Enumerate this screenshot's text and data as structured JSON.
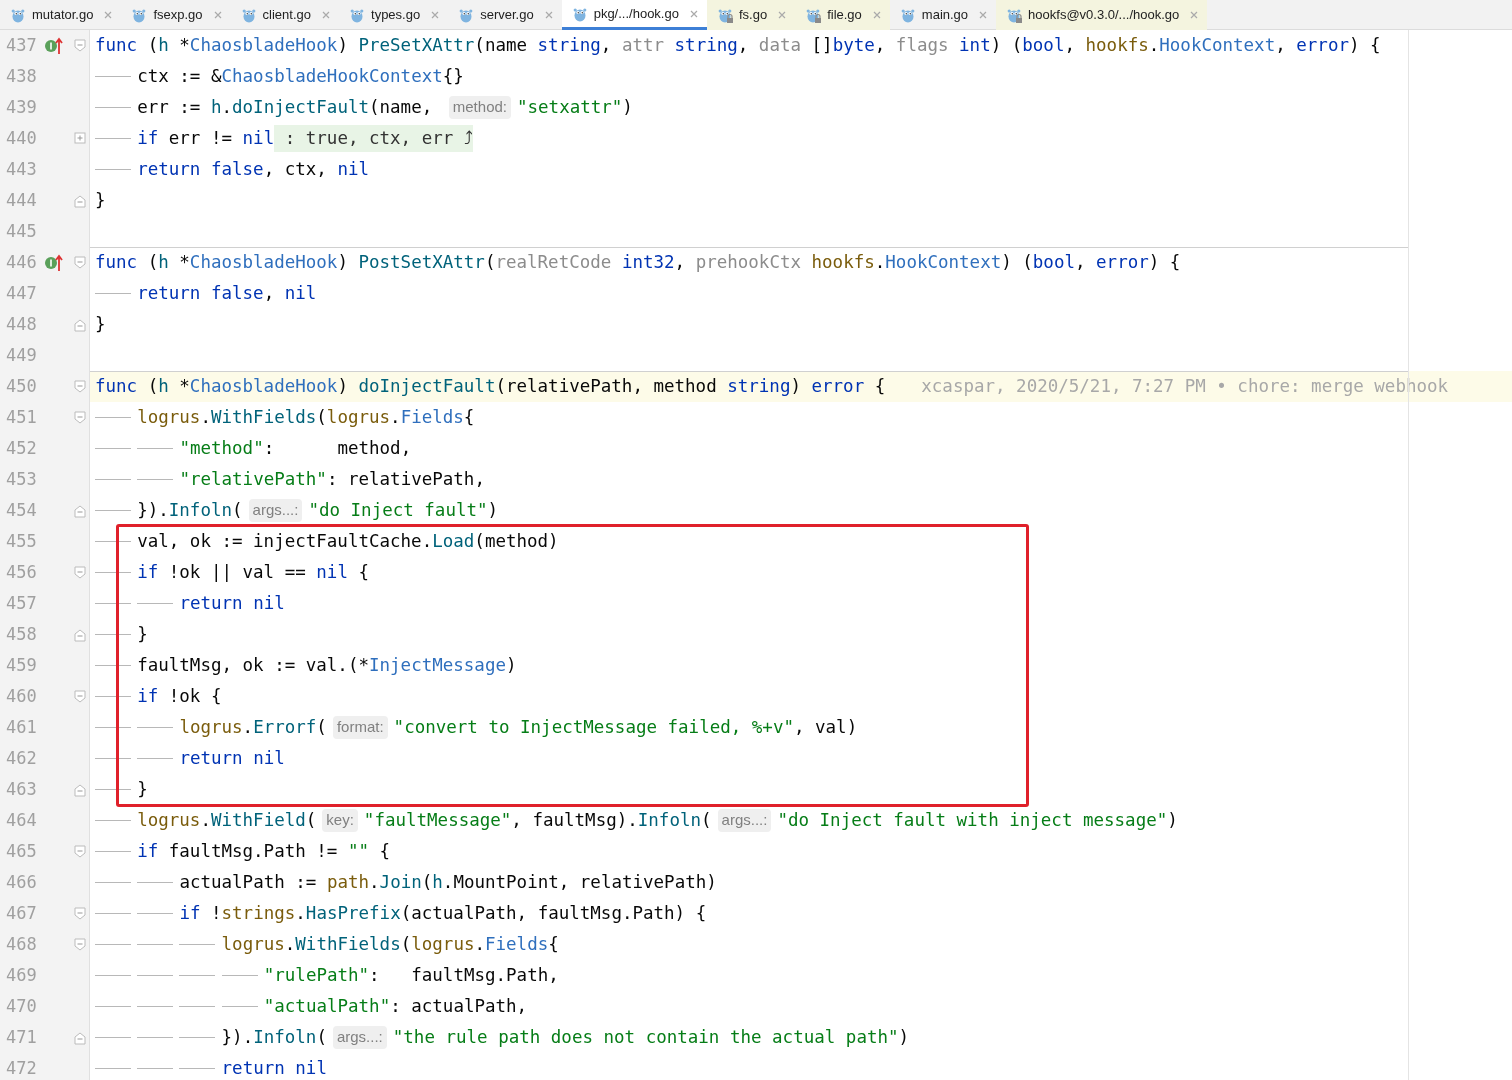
{
  "tabs": [
    {
      "label": "mutator.go",
      "selected": false,
      "library": false,
      "locked": false
    },
    {
      "label": "fsexp.go",
      "selected": false,
      "library": false,
      "locked": false
    },
    {
      "label": "client.go",
      "selected": false,
      "library": false,
      "locked": false
    },
    {
      "label": "types.go",
      "selected": false,
      "library": false,
      "locked": false
    },
    {
      "label": "server.go",
      "selected": false,
      "library": false,
      "locked": false
    },
    {
      "label": "pkg/.../hook.go",
      "selected": true,
      "library": false,
      "locked": false
    },
    {
      "label": "fs.go",
      "selected": false,
      "library": true,
      "locked": true
    },
    {
      "label": "file.go",
      "selected": false,
      "library": true,
      "locked": true
    },
    {
      "label": "main.go",
      "selected": false,
      "library": false,
      "locked": false
    },
    {
      "label": "hookfs@v0.3.0/.../hook.go",
      "selected": false,
      "library": true,
      "locked": true
    }
  ],
  "code": [
    {
      "kind": "line",
      "number": "437",
      "implements": true,
      "fold_open": true,
      "tokens": [
        {
          "kind": "kw",
          "text": "func"
        },
        {
          "kind": "plain",
          "text": " ("
        },
        {
          "kind": "recv",
          "text": "h"
        },
        {
          "kind": "plain",
          "text": " *"
        },
        {
          "kind": "type",
          "text": "ChaosbladeHook"
        },
        {
          "kind": "plain",
          "text": ") "
        },
        {
          "kind": "fn",
          "text": "PreSetXAttr"
        },
        {
          "kind": "plain",
          "text": "(name "
        },
        {
          "kind": "kw",
          "text": "string"
        },
        {
          "kind": "plain",
          "text": ", "
        },
        {
          "kind": "unused",
          "text": "attr "
        },
        {
          "kind": "kw",
          "text": "string"
        },
        {
          "kind": "plain",
          "text": ", "
        },
        {
          "kind": "unused",
          "text": "data"
        },
        {
          "kind": "plain",
          "text": " []"
        },
        {
          "kind": "kw",
          "text": "byte"
        },
        {
          "kind": "plain",
          "text": ", "
        },
        {
          "kind": "unused",
          "text": "flags "
        },
        {
          "kind": "kw",
          "text": "int"
        },
        {
          "kind": "plain",
          "text": ") ("
        },
        {
          "kind": "kw",
          "text": "bool"
        },
        {
          "kind": "plain",
          "text": ", "
        },
        {
          "kind": "pkg",
          "text": "hookfs"
        },
        {
          "kind": "plain",
          "text": "."
        },
        {
          "kind": "type",
          "text": "HookContext"
        },
        {
          "kind": "plain",
          "text": ", "
        },
        {
          "kind": "kw",
          "text": "error"
        },
        {
          "kind": "plain",
          "text": ") {"
        }
      ]
    },
    {
      "kind": "line",
      "number": "438",
      "tokens": [
        {
          "kind": "tab"
        },
        {
          "kind": "plain",
          "text": "ctx := &"
        },
        {
          "kind": "type",
          "text": "ChaosbladeHookContext"
        },
        {
          "kind": "plain",
          "text": "{}"
        }
      ]
    },
    {
      "kind": "line",
      "number": "439",
      "tokens": [
        {
          "kind": "tab"
        },
        {
          "kind": "plain",
          "text": "err := "
        },
        {
          "kind": "recv",
          "text": "h"
        },
        {
          "kind": "plain",
          "text": "."
        },
        {
          "kind": "fn",
          "text": "doInjectFault"
        },
        {
          "kind": "plain",
          "text": "(name, "
        },
        {
          "kind": "hint",
          "text": "method:"
        },
        {
          "kind": "str",
          "text": "\"setxattr\""
        },
        {
          "kind": "plain",
          "text": ")"
        }
      ]
    },
    {
      "kind": "line",
      "number": "440",
      "collapsed": true,
      "tokens": [
        {
          "kind": "tab"
        },
        {
          "kind": "kw",
          "text": "if"
        },
        {
          "kind": "plain",
          "text": " err != "
        },
        {
          "kind": "kw",
          "text": "nil"
        },
        {
          "kind": "folded",
          "text": " : true, ctx, err ⤴"
        }
      ]
    },
    {
      "kind": "line",
      "number": "443",
      "tokens": [
        {
          "kind": "tab"
        },
        {
          "kind": "kw",
          "text": "return false"
        },
        {
          "kind": "plain",
          "text": ", ctx, "
        },
        {
          "kind": "kw",
          "text": "nil"
        }
      ]
    },
    {
      "kind": "line",
      "number": "444",
      "fold_close": true,
      "tokens": [
        {
          "kind": "plain",
          "text": "}"
        }
      ]
    },
    {
      "kind": "line",
      "number": "445"
    },
    {
      "kind": "line",
      "number": "446",
      "implements": true,
      "fold_open": true,
      "separator": true,
      "tokens": [
        {
          "kind": "kw",
          "text": "func"
        },
        {
          "kind": "plain",
          "text": " ("
        },
        {
          "kind": "recv",
          "text": "h"
        },
        {
          "kind": "plain",
          "text": " *"
        },
        {
          "kind": "type",
          "text": "ChaosbladeHook"
        },
        {
          "kind": "plain",
          "text": ") "
        },
        {
          "kind": "fn",
          "text": "PostSetXAttr"
        },
        {
          "kind": "plain",
          "text": "("
        },
        {
          "kind": "unused",
          "text": "realRetCode "
        },
        {
          "kind": "kw",
          "text": "int32"
        },
        {
          "kind": "plain",
          "text": ", "
        },
        {
          "kind": "unused",
          "text": "prehookCtx "
        },
        {
          "kind": "pkg",
          "text": "hookfs"
        },
        {
          "kind": "plain",
          "text": "."
        },
        {
          "kind": "type",
          "text": "HookContext"
        },
        {
          "kind": "plain",
          "text": ") ("
        },
        {
          "kind": "kw",
          "text": "bool"
        },
        {
          "kind": "plain",
          "text": ", "
        },
        {
          "kind": "kw",
          "text": "error"
        },
        {
          "kind": "plain",
          "text": ") {"
        }
      ]
    },
    {
      "kind": "line",
      "number": "447",
      "tokens": [
        {
          "kind": "tab"
        },
        {
          "kind": "kw",
          "text": "return false"
        },
        {
          "kind": "plain",
          "text": ", "
        },
        {
          "kind": "kw",
          "text": "nil"
        }
      ]
    },
    {
      "kind": "line",
      "number": "448",
      "fold_close": true,
      "tokens": [
        {
          "kind": "plain",
          "text": "}"
        }
      ]
    },
    {
      "kind": "line",
      "number": "449"
    },
    {
      "kind": "line",
      "number": "450",
      "fold_open": true,
      "separator": true,
      "current": true,
      "tokens": [
        {
          "kind": "kw",
          "text": "func"
        },
        {
          "kind": "plain",
          "text": " ("
        },
        {
          "kind": "recv",
          "text": "h"
        },
        {
          "kind": "plain",
          "text": " *"
        },
        {
          "kind": "type",
          "text": "ChaosbladeHook"
        },
        {
          "kind": "plain",
          "text": ") "
        },
        {
          "kind": "fn",
          "text": "doInjectFault"
        },
        {
          "kind": "plain",
          "text": "(relativePath, method "
        },
        {
          "kind": "kw",
          "text": "string"
        },
        {
          "kind": "plain",
          "text": ") "
        },
        {
          "kind": "kw",
          "text": "error"
        },
        {
          "kind": "plain",
          "text": " {"
        },
        {
          "kind": "blame",
          "text": "xcaspar, 2020/5/21, 7:27 PM • chore: merge webhook"
        }
      ]
    },
    {
      "kind": "line",
      "number": "451",
      "fold_open": true,
      "tokens": [
        {
          "kind": "tab"
        },
        {
          "kind": "pkg",
          "text": "logrus"
        },
        {
          "kind": "plain",
          "text": "."
        },
        {
          "kind": "fn",
          "text": "WithFields"
        },
        {
          "kind": "plain",
          "text": "("
        },
        {
          "kind": "pkg",
          "text": "logrus"
        },
        {
          "kind": "plain",
          "text": "."
        },
        {
          "kind": "type",
          "text": "Fields"
        },
        {
          "kind": "plain",
          "text": "{"
        }
      ]
    },
    {
      "kind": "line",
      "number": "452",
      "tokens": [
        {
          "kind": "tab"
        },
        {
          "kind": "tab"
        },
        {
          "kind": "str",
          "text": "\"method\""
        },
        {
          "kind": "plain",
          "text": ":      method,"
        }
      ]
    },
    {
      "kind": "line",
      "number": "453",
      "tokens": [
        {
          "kind": "tab"
        },
        {
          "kind": "tab"
        },
        {
          "kind": "str",
          "text": "\"relativePath\""
        },
        {
          "kind": "plain",
          "text": ": relativePath,"
        }
      ]
    },
    {
      "kind": "line",
      "number": "454",
      "fold_close": true,
      "tokens": [
        {
          "kind": "tab"
        },
        {
          "kind": "plain",
          "text": "})."
        },
        {
          "kind": "fn",
          "text": "Infoln"
        },
        {
          "kind": "plain",
          "text": "("
        },
        {
          "kind": "hint",
          "text": "args...:"
        },
        {
          "kind": "str",
          "text": "\"do Inject fault\""
        },
        {
          "kind": "plain",
          "text": ")"
        }
      ]
    },
    {
      "kind": "boxed",
      "lines": [
        {
          "kind": "line",
          "number": "455",
          "tokens": [
            {
              "kind": "tab"
            },
            {
              "kind": "plain",
              "text": "val, ok := injectFaultCache."
            },
            {
              "kind": "fn",
              "text": "Load"
            },
            {
              "kind": "plain",
              "text": "(method)"
            }
          ]
        },
        {
          "kind": "line",
          "number": "456",
          "fold_open": true,
          "tokens": [
            {
              "kind": "tab"
            },
            {
              "kind": "kw",
              "text": "if"
            },
            {
              "kind": "plain",
              "text": " !ok || val == "
            },
            {
              "kind": "kw",
              "text": "nil"
            },
            {
              "kind": "plain",
              "text": " {"
            }
          ]
        },
        {
          "kind": "line",
          "number": "457",
          "tokens": [
            {
              "kind": "tab"
            },
            {
              "kind": "tab"
            },
            {
              "kind": "kw",
              "text": "return nil"
            }
          ]
        },
        {
          "kind": "line",
          "number": "458",
          "fold_close": true,
          "tokens": [
            {
              "kind": "tab"
            },
            {
              "kind": "plain",
              "text": "}"
            }
          ]
        },
        {
          "kind": "line",
          "number": "459",
          "tokens": [
            {
              "kind": "tab"
            },
            {
              "kind": "plain",
              "text": "faultMsg, ok := val.(*"
            },
            {
              "kind": "type",
              "text": "InjectMessage"
            },
            {
              "kind": "plain",
              "text": ")"
            }
          ]
        },
        {
          "kind": "line",
          "number": "460",
          "fold_open": true,
          "tokens": [
            {
              "kind": "tab"
            },
            {
              "kind": "kw",
              "text": "if"
            },
            {
              "kind": "plain",
              "text": " !ok {"
            }
          ]
        },
        {
          "kind": "line",
          "number": "461",
          "tokens": [
            {
              "kind": "tab"
            },
            {
              "kind": "tab"
            },
            {
              "kind": "pkg",
              "text": "logrus"
            },
            {
              "kind": "plain",
              "text": "."
            },
            {
              "kind": "fn",
              "text": "Errorf"
            },
            {
              "kind": "plain",
              "text": "("
            },
            {
              "kind": "hint",
              "text": "format:"
            },
            {
              "kind": "str",
              "text": "\"convert to InjectMessage failed, %+v\""
            },
            {
              "kind": "plain",
              "text": ", val)"
            }
          ]
        },
        {
          "kind": "line",
          "number": "462",
          "tokens": [
            {
              "kind": "tab"
            },
            {
              "kind": "tab"
            },
            {
              "kind": "kw",
              "text": "return nil"
            }
          ]
        },
        {
          "kind": "line",
          "number": "463",
          "fold_close": true,
          "tokens": [
            {
              "kind": "tab"
            },
            {
              "kind": "plain",
              "text": "}"
            }
          ]
        }
      ]
    },
    {
      "kind": "line",
      "number": "464",
      "tokens": [
        {
          "kind": "tab"
        },
        {
          "kind": "pkg",
          "text": "logrus"
        },
        {
          "kind": "plain",
          "text": "."
        },
        {
          "kind": "fn",
          "text": "WithField"
        },
        {
          "kind": "plain",
          "text": "("
        },
        {
          "kind": "hint",
          "text": "key:"
        },
        {
          "kind": "str",
          "text": "\"faultMessage\""
        },
        {
          "kind": "plain",
          "text": ", faultMsg)."
        },
        {
          "kind": "fn",
          "text": "Infoln"
        },
        {
          "kind": "plain",
          "text": "("
        },
        {
          "kind": "hint",
          "text": "args...:"
        },
        {
          "kind": "str",
          "text": "\"do Inject fault with inject message\""
        },
        {
          "kind": "plain",
          "text": ")"
        }
      ]
    },
    {
      "kind": "line",
      "number": "465",
      "fold_open": true,
      "tokens": [
        {
          "kind": "tab"
        },
        {
          "kind": "kw",
          "text": "if"
        },
        {
          "kind": "plain",
          "text": " faultMsg.Path != "
        },
        {
          "kind": "str",
          "text": "\"\""
        },
        {
          "kind": "plain",
          "text": " {"
        }
      ]
    },
    {
      "kind": "line",
      "number": "466",
      "tokens": [
        {
          "kind": "tab"
        },
        {
          "kind": "tab"
        },
        {
          "kind": "plain",
          "text": "actualPath := "
        },
        {
          "kind": "pkg",
          "text": "path"
        },
        {
          "kind": "plain",
          "text": "."
        },
        {
          "kind": "fn",
          "text": "Join"
        },
        {
          "kind": "plain",
          "text": "("
        },
        {
          "kind": "recv",
          "text": "h"
        },
        {
          "kind": "plain",
          "text": ".MountPoint, relativePath)"
        }
      ]
    },
    {
      "kind": "line",
      "number": "467",
      "fold_open": true,
      "tokens": [
        {
          "kind": "tab"
        },
        {
          "kind": "tab"
        },
        {
          "kind": "kw",
          "text": "if"
        },
        {
          "kind": "plain",
          "text": " !"
        },
        {
          "kind": "pkg",
          "text": "strings"
        },
        {
          "kind": "plain",
          "text": "."
        },
        {
          "kind": "fn",
          "text": "HasPrefix"
        },
        {
          "kind": "plain",
          "text": "(actualPath, faultMsg.Path) {"
        }
      ]
    },
    {
      "kind": "line",
      "number": "468",
      "fold_open": true,
      "tokens": [
        {
          "kind": "tab"
        },
        {
          "kind": "tab"
        },
        {
          "kind": "tab"
        },
        {
          "kind": "pkg",
          "text": "logrus"
        },
        {
          "kind": "plain",
          "text": "."
        },
        {
          "kind": "fn",
          "text": "WithFields"
        },
        {
          "kind": "plain",
          "text": "("
        },
        {
          "kind": "pkg",
          "text": "logrus"
        },
        {
          "kind": "plain",
          "text": "."
        },
        {
          "kind": "type",
          "text": "Fields"
        },
        {
          "kind": "plain",
          "text": "{"
        }
      ]
    },
    {
      "kind": "line",
      "number": "469",
      "tokens": [
        {
          "kind": "tab"
        },
        {
          "kind": "tab"
        },
        {
          "kind": "tab"
        },
        {
          "kind": "tab"
        },
        {
          "kind": "str",
          "text": "\"rulePath\""
        },
        {
          "kind": "plain",
          "text": ":   faultMsg.Path,"
        }
      ]
    },
    {
      "kind": "line",
      "number": "470",
      "tokens": [
        {
          "kind": "tab"
        },
        {
          "kind": "tab"
        },
        {
          "kind": "tab"
        },
        {
          "kind": "tab"
        },
        {
          "kind": "str",
          "text": "\"actualPath\""
        },
        {
          "kind": "plain",
          "text": ": actualPath,"
        }
      ]
    },
    {
      "kind": "line",
      "number": "471",
      "fold_close": true,
      "tokens": [
        {
          "kind": "tab"
        },
        {
          "kind": "tab"
        },
        {
          "kind": "tab"
        },
        {
          "kind": "plain",
          "text": "})."
        },
        {
          "kind": "fn",
          "text": "Infoln"
        },
        {
          "kind": "plain",
          "text": "("
        },
        {
          "kind": "hint",
          "text": "args...:"
        },
        {
          "kind": "str",
          "text": "\"the rule path does not contain the actual path\""
        },
        {
          "kind": "plain",
          "text": ")"
        }
      ]
    },
    {
      "kind": "line",
      "number": "472",
      "tokens": [
        {
          "kind": "tab"
        },
        {
          "kind": "tab"
        },
        {
          "kind": "tab"
        },
        {
          "kind": "kw",
          "text": "return nil"
        }
      ]
    }
  ]
}
